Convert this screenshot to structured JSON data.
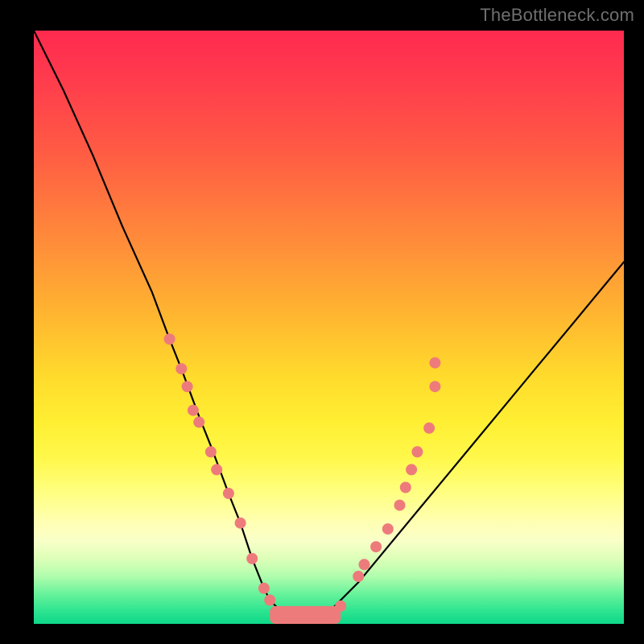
{
  "watermark": "TheBottleneck.com",
  "chart_data": {
    "type": "line",
    "title": "",
    "xlabel": "",
    "ylabel": "",
    "xlim": [
      0,
      100
    ],
    "ylim": [
      0,
      100
    ],
    "grid": false,
    "legend": "none",
    "series": [
      {
        "name": "bottleneck-curve",
        "color": "#000000",
        "x": [
          0,
          5,
          10,
          15,
          20,
          23,
          25,
          28,
          30,
          33,
          35,
          37,
          39,
          40,
          42,
          45,
          48,
          50,
          55,
          60,
          65,
          70,
          75,
          80,
          85,
          90,
          95,
          100
        ],
        "y": [
          100,
          90,
          79,
          67,
          56,
          48,
          43,
          35,
          30,
          22,
          17,
          11,
          6,
          4,
          2,
          0,
          0,
          2,
          7,
          13,
          19,
          25,
          31,
          37,
          43,
          49,
          55,
          61
        ]
      }
    ],
    "annotations": [
      {
        "type": "scatter",
        "name": "dots-left",
        "color": "#ee7b7b",
        "points": [
          [
            23,
            48
          ],
          [
            25,
            43
          ],
          [
            26,
            40
          ],
          [
            27,
            36
          ],
          [
            28,
            34
          ],
          [
            30,
            29
          ],
          [
            31,
            26
          ],
          [
            33,
            22
          ],
          [
            35,
            17
          ],
          [
            37,
            11
          ],
          [
            39,
            6
          ],
          [
            40,
            4
          ],
          [
            42,
            2
          ]
        ]
      },
      {
        "type": "scatter",
        "name": "dots-right",
        "color": "#ee7b7b",
        "points": [
          [
            52,
            3
          ],
          [
            55,
            8
          ],
          [
            56,
            10
          ],
          [
            58,
            13
          ],
          [
            60,
            16
          ],
          [
            62,
            20
          ],
          [
            63,
            23
          ],
          [
            64,
            26
          ],
          [
            65,
            29
          ],
          [
            67,
            33
          ],
          [
            68,
            40
          ],
          [
            68,
            44
          ]
        ]
      },
      {
        "type": "bar-band",
        "name": "valley-band",
        "color": "#ee7b7b",
        "x_range": [
          40,
          52
        ],
        "y": 0,
        "height": 3
      }
    ],
    "background_gradient": {
      "type": "vertical",
      "stops": [
        {
          "pos": 0.0,
          "color": "#ff2a4f"
        },
        {
          "pos": 0.35,
          "color": "#ff8a3a"
        },
        {
          "pos": 0.6,
          "color": "#ffe22f"
        },
        {
          "pos": 0.85,
          "color": "#f1ffc0"
        },
        {
          "pos": 1.0,
          "color": "#0dd889"
        }
      ]
    }
  }
}
